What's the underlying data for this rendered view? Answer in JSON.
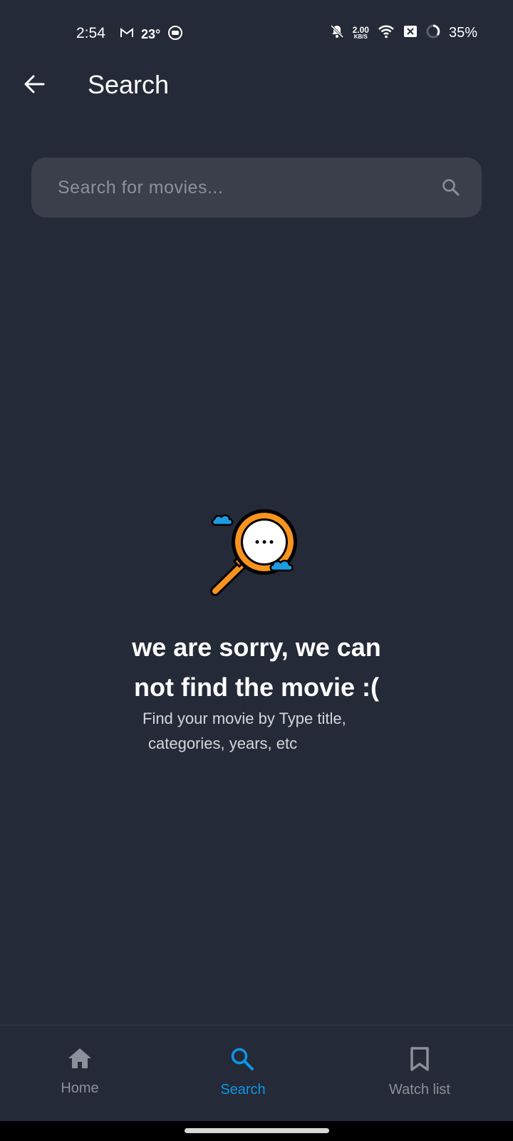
{
  "status_bar": {
    "time": "2:54",
    "temperature": "23°",
    "net_speed_value": "2.00",
    "net_speed_unit": "KB/S",
    "battery": "35%"
  },
  "app_bar": {
    "title": "Search"
  },
  "search": {
    "placeholder": "Search for movies...",
    "value": ""
  },
  "empty_state": {
    "title_line1": "we are sorry, we can",
    "title_line2": "not find the movie :(",
    "subtitle_line1": "Find your movie by Type title,",
    "subtitle_line2": "categories, years, etc"
  },
  "bottom_nav": {
    "items": [
      {
        "label": "Home",
        "icon": "home-icon",
        "active": false
      },
      {
        "label": "Search",
        "icon": "search-icon",
        "active": true
      },
      {
        "label": "Watch list",
        "icon": "bookmark-icon",
        "active": false
      }
    ]
  },
  "colors": {
    "background": "#242A37",
    "search_field": "#3A3F4B",
    "accent": "#0C96E8",
    "inactive": "#8C909A",
    "illustration_orange": "#F7931E",
    "illustration_blue": "#1E9BE0"
  }
}
